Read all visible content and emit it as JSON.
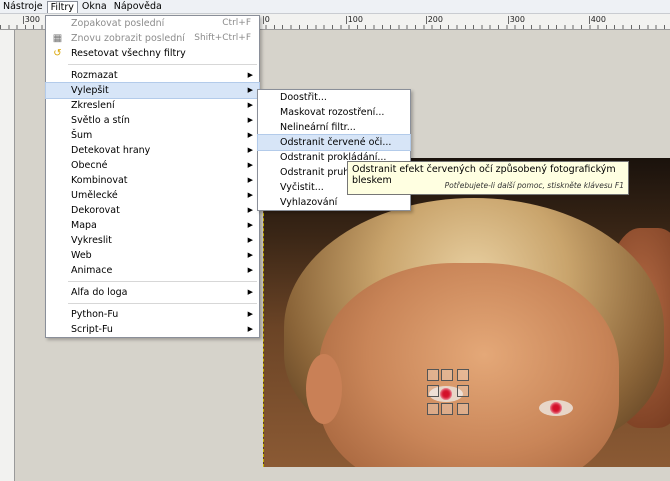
{
  "menubar": {
    "items": [
      {
        "label": "Nástroje"
      },
      {
        "label": "Filtry"
      },
      {
        "label": "Okna"
      },
      {
        "label": "Nápověda"
      }
    ]
  },
  "ruler": {
    "labels": [
      "|300",
      "|0",
      "|100",
      "|200",
      "|300",
      "|400"
    ]
  },
  "filters_menu": {
    "repeat_last": {
      "label": "Zopakovat poslední",
      "accel": "Ctrl+F"
    },
    "reshow_last": {
      "label": "Znovu zobrazit poslední",
      "accel": "Shift+Ctrl+F"
    },
    "reset_all": {
      "label": "Resetovat všechny filtry"
    },
    "categories": [
      "Rozmazat",
      "Vylepšit",
      "Zkreslení",
      "Světlo a stín",
      "Šum",
      "Detekovat hrany",
      "Obecné",
      "Kombinovat",
      "Umělecké",
      "Dekorovat",
      "Mapa",
      "Vykreslit",
      "Web",
      "Animace"
    ],
    "alpha_to_logo": "Alfa do loga",
    "python_fu": "Python-Fu",
    "script_fu": "Script-Fu"
  },
  "enhance_menu": {
    "items": [
      "Doostřit...",
      "Maskovat rozostření...",
      "Nelineární filtr...",
      "Odstranit červené oči...",
      "Odstranit prokládání...",
      "Odstranit pruhy...",
      "Vyčistit...",
      "Vyhlazování"
    ]
  },
  "tooltip": {
    "text": "Odstranit efekt červených očí způsobený fotografickým bleskem",
    "help": "Potřebujete-li další pomoc, stiskněte klávesu F1"
  },
  "colors": {
    "highlight": "#d7e5f7",
    "tooltip_bg": "#ffffe1",
    "red_eye": "#d4102a"
  },
  "icons": {
    "reshow": "reshow-filter-icon",
    "reset": "reset-filters-icon"
  }
}
